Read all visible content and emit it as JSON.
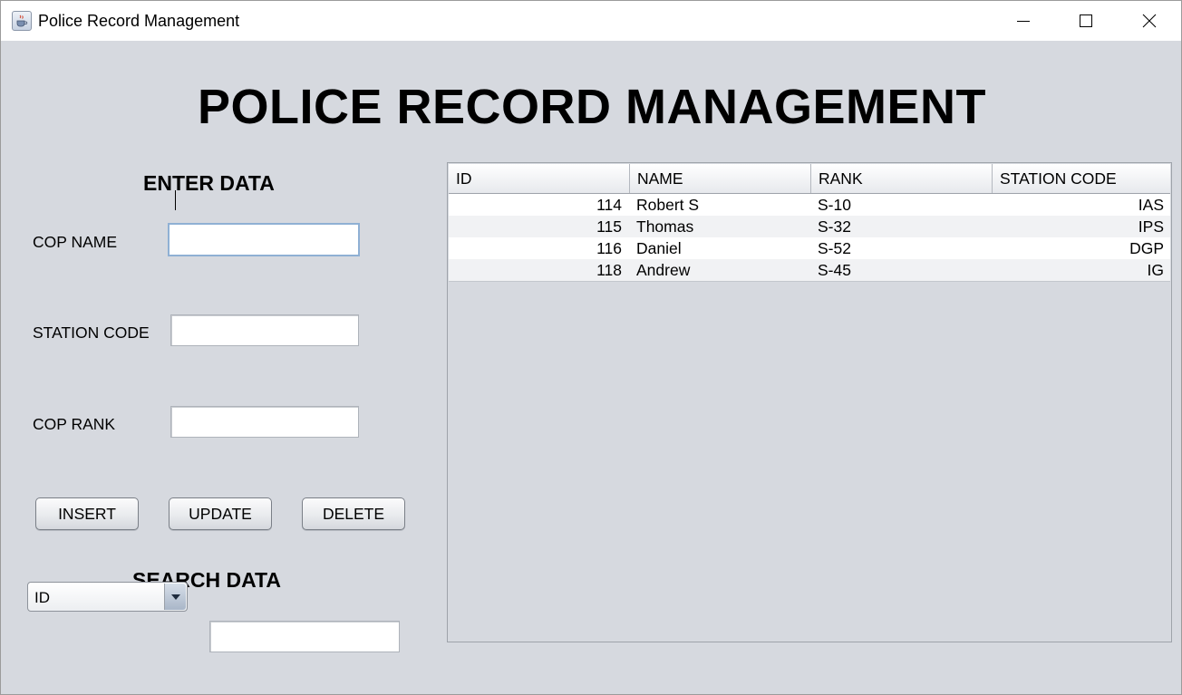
{
  "window": {
    "title": "Police Record Management"
  },
  "main": {
    "heading": "POLICE RECORD MANAGEMENT"
  },
  "form": {
    "section_title": "ENTER DATA",
    "cop_name_label": "COP NAME",
    "cop_name_value": "",
    "station_code_label": "STATION CODE",
    "station_code_value": "",
    "cop_rank_label": "COP RANK",
    "cop_rank_value": "",
    "insert_label": "INSERT",
    "update_label": "UPDATE",
    "delete_label": "DELETE"
  },
  "search": {
    "section_title": "SEARCH DATA",
    "selected_option": "ID",
    "value": ""
  },
  "table": {
    "columns": [
      "ID",
      "NAME",
      "RANK",
      "STATION CODE"
    ],
    "rows": [
      {
        "id": "114",
        "name": "Robert S",
        "rank": "S-10",
        "station_code": "IAS"
      },
      {
        "id": "115",
        "name": "Thomas",
        "rank": "S-32",
        "station_code": "IPS"
      },
      {
        "id": "116",
        "name": "Daniel",
        "rank": "S-52",
        "station_code": "DGP"
      },
      {
        "id": "118",
        "name": "Andrew",
        "rank": "S-45",
        "station_code": "IG"
      }
    ]
  },
  "icons": {
    "app": "java-coffee-cup-icon",
    "minimize": "minimize-icon",
    "maximize": "maximize-icon",
    "close": "close-icon",
    "dropdown": "chevron-down-icon"
  }
}
